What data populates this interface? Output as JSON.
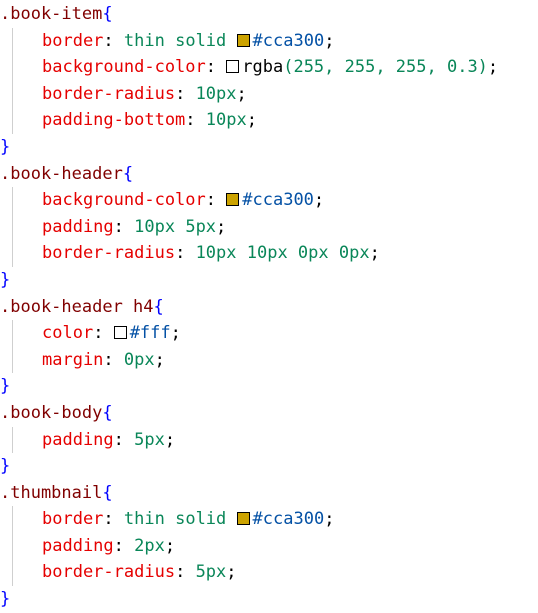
{
  "colors": {
    "accent_gold": "#cca300",
    "selector": "#800000",
    "brace": "#0000ff",
    "property": "#e50000",
    "number": "#098658",
    "hex": "#0451a5",
    "swatch_white": "#ffffff"
  },
  "code": {
    "r1": {
      "selector": ".book-item",
      "open": "{",
      "close": "}",
      "d1": {
        "prop": "border",
        "colon": ":",
        "val": "thin solid",
        "hex": "#cca300",
        "semi": ";"
      },
      "d2": {
        "prop": "background-color",
        "colon": ":",
        "fn": "rgba",
        "args": "(255, 255, 255, 0.3)",
        "semi": ";"
      },
      "d3": {
        "prop": "border-radius",
        "colon": ":",
        "val": "10px",
        "semi": ";"
      },
      "d4": {
        "prop": "padding-bottom",
        "colon": ":",
        "val": "10px",
        "semi": ";"
      }
    },
    "r2": {
      "selector": ".book-header",
      "open": "{",
      "close": "}",
      "d1": {
        "prop": "background-color",
        "colon": ":",
        "hex": "#cca300",
        "semi": ";"
      },
      "d2": {
        "prop": "padding",
        "colon": ":",
        "val": "10px 5px",
        "semi": ";"
      },
      "d3": {
        "prop": "border-radius",
        "colon": ":",
        "val": "10px 10px 0px 0px",
        "semi": ";"
      }
    },
    "r3": {
      "selector": ".book-header h4",
      "open": "{",
      "close": "}",
      "d1": {
        "prop": "color",
        "colon": ":",
        "hex": "#fff",
        "semi": ";"
      },
      "d2": {
        "prop": "margin",
        "colon": ":",
        "val": "0px",
        "semi": ";"
      }
    },
    "r4": {
      "selector": ".book-body",
      "open": "{",
      "close": "}",
      "d1": {
        "prop": "padding",
        "colon": ":",
        "val": "5px",
        "semi": ";"
      }
    },
    "r5": {
      "selector": ".thumbnail",
      "open": "{",
      "close": "}",
      "d1": {
        "prop": "border",
        "colon": ":",
        "val": "thin solid",
        "hex": "#cca300",
        "semi": ";"
      },
      "d2": {
        "prop": "padding",
        "colon": ":",
        "val": "2px",
        "semi": ";"
      },
      "d3": {
        "prop": "border-radius",
        "colon": ":",
        "val": "5px",
        "semi": ";"
      }
    }
  }
}
